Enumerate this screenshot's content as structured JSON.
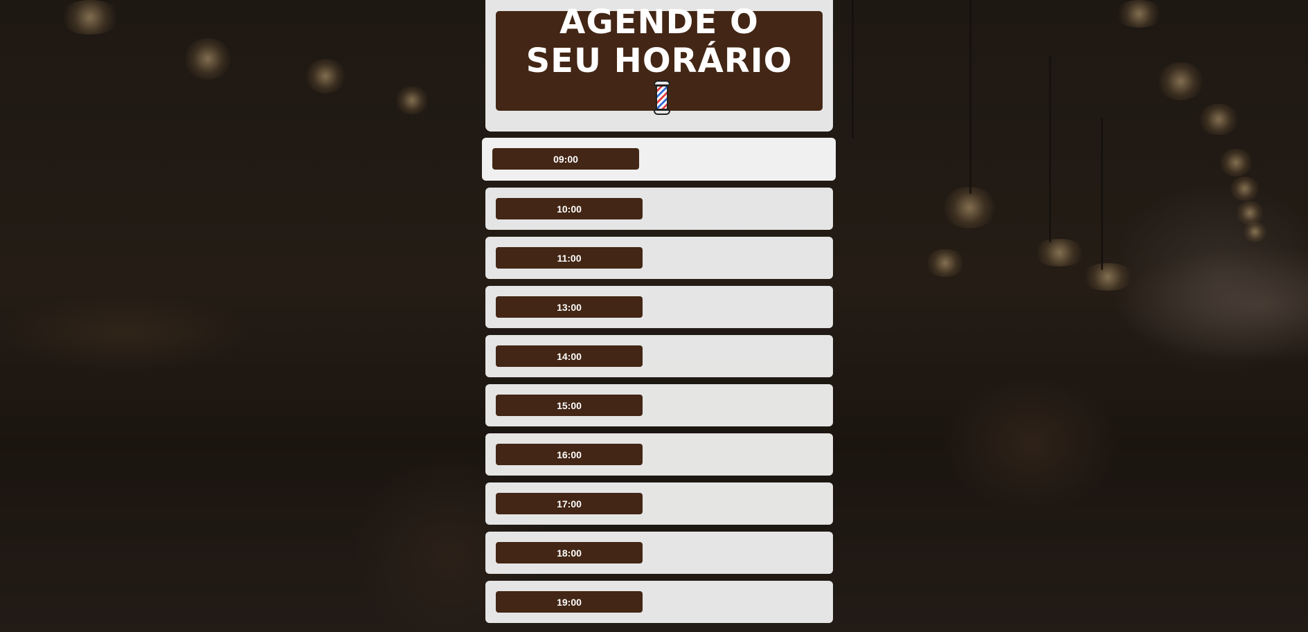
{
  "header": {
    "title": "AGENDE O SEU HORÁRIO",
    "icon": "barber-pole-icon"
  },
  "slots": [
    {
      "time": "09:00",
      "state": "hover"
    },
    {
      "time": "10:00"
    },
    {
      "time": "11:00"
    },
    {
      "time": "13:00"
    },
    {
      "time": "14:00"
    },
    {
      "time": "15:00"
    },
    {
      "time": "16:00"
    },
    {
      "time": "17:00"
    },
    {
      "time": "18:00"
    },
    {
      "time": "19:00"
    }
  ],
  "colors": {
    "brand_brown": "#432615",
    "card_bg": "#f0f0f0",
    "text_on_brown": "#ffffff"
  }
}
